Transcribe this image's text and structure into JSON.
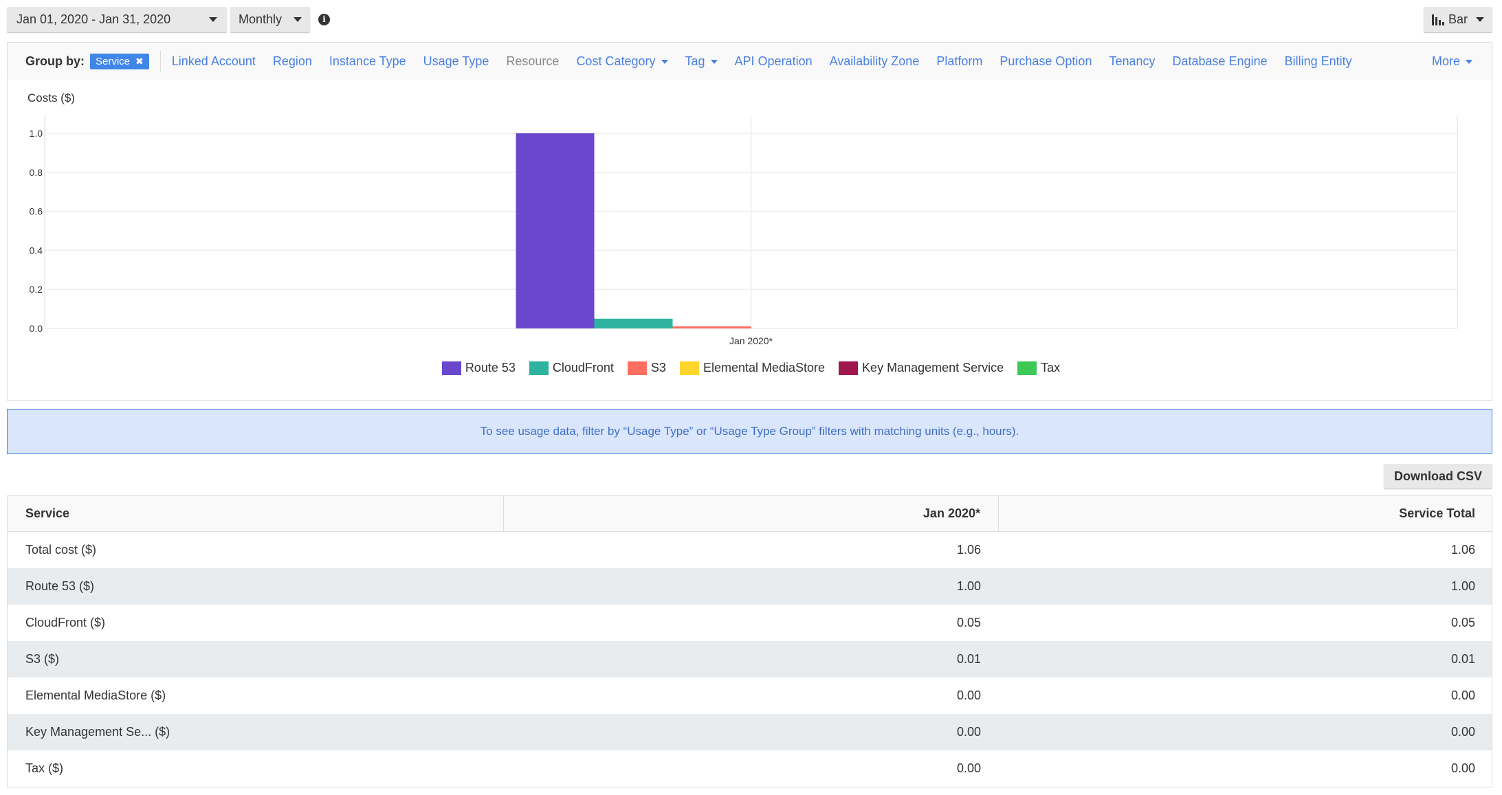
{
  "toolbar": {
    "date_range": "Jan 01, 2020 - Jan 31, 2020",
    "granularity": "Monthly",
    "info_icon": "info-circle-icon",
    "chart_type": "Bar",
    "chart_type_icon": "bar-chart-icon"
  },
  "group_by": {
    "label": "Group by:",
    "selected": "Service",
    "options": [
      {
        "label": "Linked Account",
        "enabled": true
      },
      {
        "label": "Region",
        "enabled": true
      },
      {
        "label": "Instance Type",
        "enabled": true
      },
      {
        "label": "Usage Type",
        "enabled": true
      },
      {
        "label": "Resource",
        "enabled": false
      },
      {
        "label": "Cost Category",
        "enabled": true,
        "dropdown": true
      },
      {
        "label": "Tag",
        "enabled": true,
        "dropdown": true
      },
      {
        "label": "API Operation",
        "enabled": true
      },
      {
        "label": "Availability Zone",
        "enabled": true
      },
      {
        "label": "Platform",
        "enabled": true
      },
      {
        "label": "Purchase Option",
        "enabled": true
      },
      {
        "label": "Tenancy",
        "enabled": true
      },
      {
        "label": "Database Engine",
        "enabled": true
      },
      {
        "label": "Billing Entity",
        "enabled": true
      }
    ],
    "more_label": "More"
  },
  "chart_data": {
    "type": "bar",
    "title": "",
    "ylabel": "Costs ($)",
    "xlabel": "",
    "categories": [
      "Jan 2020*"
    ],
    "ylim": [
      0,
      1.0
    ],
    "yticks": [
      "0.0",
      "0.2",
      "0.4",
      "0.6",
      "0.8",
      "1.0"
    ],
    "grid": true,
    "legend_position": "bottom",
    "series": [
      {
        "name": "Route 53",
        "color": "#6a47cc",
        "values": [
          1.0
        ]
      },
      {
        "name": "CloudFront",
        "color": "#2eb3a0",
        "values": [
          0.05
        ]
      },
      {
        "name": "S3",
        "color": "#ff6f5f",
        "values": [
          0.01
        ]
      },
      {
        "name": "Elemental MediaStore",
        "color": "#ffd52e",
        "values": [
          0.0
        ]
      },
      {
        "name": "Key Management Service",
        "color": "#a0174f",
        "values": [
          0.0
        ]
      },
      {
        "name": "Tax",
        "color": "#3ec956",
        "values": [
          0.0
        ]
      }
    ]
  },
  "banner": {
    "text": "To see usage data, filter by “Usage Type” or “Usage Type Group” filters with matching units (e.g., hours)."
  },
  "download_label": "Download CSV",
  "table": {
    "headers": [
      "Service",
      "Jan 2020*",
      "Service Total"
    ],
    "rows": [
      {
        "service": "Total cost ($)",
        "jan": "1.06",
        "total": "1.06"
      },
      {
        "service": "Route 53 ($)",
        "jan": "1.00",
        "total": "1.00"
      },
      {
        "service": "CloudFront ($)",
        "jan": "0.05",
        "total": "0.05"
      },
      {
        "service": "S3 ($)",
        "jan": "0.01",
        "total": "0.01"
      },
      {
        "service": "Elemental MediaStore ($)",
        "jan": "0.00",
        "total": "0.00"
      },
      {
        "service": "Key Management Se... ($)",
        "jan": "0.00",
        "total": "0.00"
      },
      {
        "service": "Tax ($)",
        "jan": "0.00",
        "total": "0.00"
      }
    ]
  }
}
